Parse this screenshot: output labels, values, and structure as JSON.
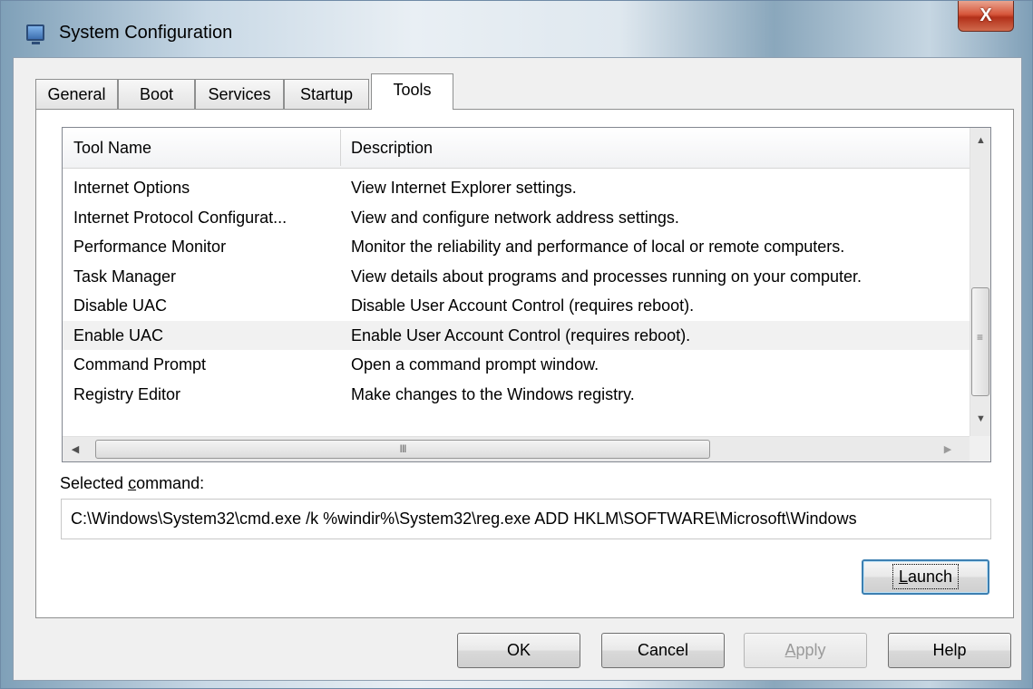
{
  "window": {
    "title": "System Configuration",
    "close_label": "X"
  },
  "tabs": [
    {
      "label": "General",
      "active": false
    },
    {
      "label": "Boot",
      "active": false
    },
    {
      "label": "Services",
      "active": false
    },
    {
      "label": "Startup",
      "active": false
    },
    {
      "label": "Tools",
      "active": true
    }
  ],
  "tools_list": {
    "columns": [
      "Tool Name",
      "Description"
    ],
    "rows": [
      {
        "name": "Internet Options",
        "description": "View Internet Explorer settings."
      },
      {
        "name": "Internet Protocol Configurat...",
        "description": "View and configure network address settings."
      },
      {
        "name": "Performance Monitor",
        "description": "Monitor the reliability and performance of local or remote computers."
      },
      {
        "name": "Task Manager",
        "description": "View details about programs and processes running on your computer."
      },
      {
        "name": "Disable UAC",
        "description": "Disable User Account Control (requires reboot)."
      },
      {
        "name": "Enable UAC",
        "description": "Enable User Account Control (requires reboot)."
      },
      {
        "name": "Command Prompt",
        "description": "Open a command prompt window."
      },
      {
        "name": "Registry Editor",
        "description": "Make changes to the Windows registry."
      }
    ],
    "highlighted_row": "Enable UAC",
    "hscroll_grip": "III",
    "vscroll_grip": "≡"
  },
  "selected_command": {
    "label_prefix": "Selected ",
    "label_underlined": "c",
    "label_suffix": "ommand:",
    "value": "C:\\Windows\\System32\\cmd.exe /k %windir%\\System32\\reg.exe ADD HKLM\\SOFTWARE\\Microsoft\\Windows"
  },
  "launch_button": {
    "underlined": "L",
    "rest": "aunch"
  },
  "footer_buttons": {
    "ok": "OK",
    "cancel": "Cancel",
    "apply_underlined": "A",
    "apply_rest": "pply",
    "help": "Help"
  }
}
